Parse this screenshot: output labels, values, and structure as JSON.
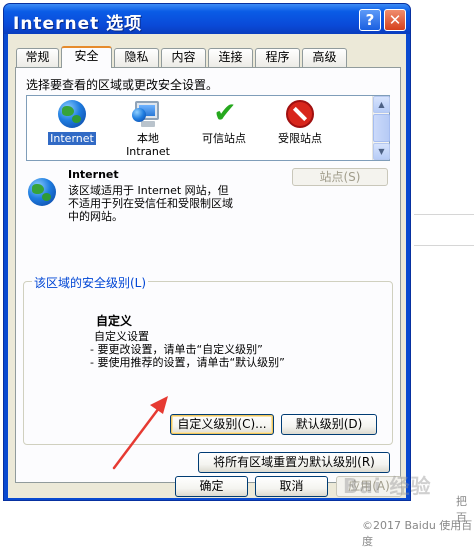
{
  "window": {
    "title": "Internet 选项",
    "help_label": "?",
    "close_label": "✕"
  },
  "tabs": [
    {
      "label": "常规",
      "active": false
    },
    {
      "label": "安全",
      "active": true
    },
    {
      "label": "隐私",
      "active": false
    },
    {
      "label": "内容",
      "active": false
    },
    {
      "label": "连接",
      "active": false
    },
    {
      "label": "程序",
      "active": false
    },
    {
      "label": "高级",
      "active": false
    }
  ],
  "security": {
    "prompt": "选择要查看的区域或更改安全设置。",
    "zones": [
      {
        "label": "Internet",
        "label2": "",
        "icon": "globe-icon",
        "selected": true
      },
      {
        "label": "本地",
        "label2": "Intranet",
        "icon": "local-intranet-icon",
        "selected": false
      },
      {
        "label": "可信站点",
        "label2": "",
        "icon": "check-icon",
        "selected": false
      },
      {
        "label": "受限站点",
        "label2": "",
        "icon": "restricted-icon",
        "selected": false
      }
    ],
    "zone_info": {
      "name": "Internet",
      "desc_lines": [
        "该区域适用于 Internet 网站，但",
        "不适用于列在受信任和受限制区域",
        "中的网站。"
      ]
    },
    "sites_button": "站点(S)",
    "level_group_title": "该区域的安全级别(L)",
    "level": {
      "title": "自定义",
      "lines": [
        "自定义设置",
        "- 要更改设置，请单击“自定义级别”",
        "- 要使用推荐的设置，请单击“默认级别”"
      ]
    },
    "custom_level_button": "自定义级别(C)...",
    "default_level_button": "默认级别(D)",
    "reset_all_button": "将所有区域重置为默认级别(R)"
  },
  "footer": {
    "ok": "确定",
    "cancel": "取消",
    "apply": "应用(A)"
  },
  "watermark": {
    "copyright": "©2017 Baidu 使用百度",
    "logo_text": "Bai 经验",
    "side_text": "把百"
  },
  "colors": {
    "titlebar": "#0a4ad8",
    "accent_tab": "#e68b2c",
    "selection": "#316ac5",
    "arrow": "#e63a32"
  }
}
